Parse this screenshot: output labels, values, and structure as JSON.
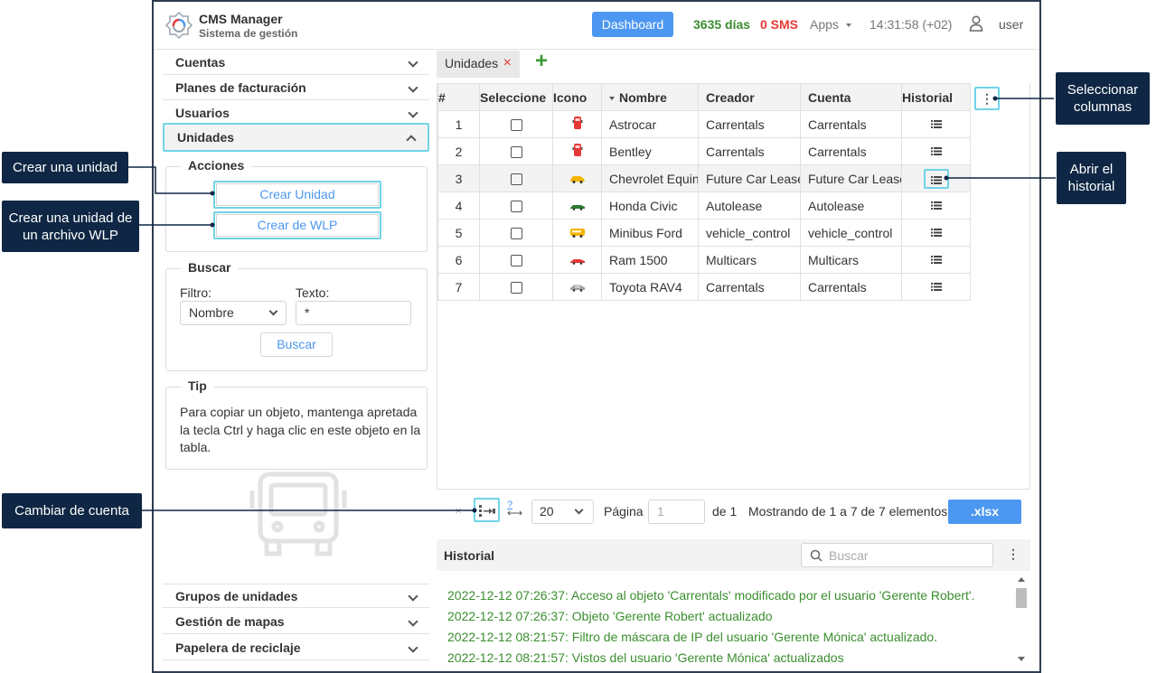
{
  "header": {
    "app_title": "CMS Manager",
    "app_subtitle": "Sistema de gestión",
    "dashboard_label": "Dashboard",
    "days": "3635 días",
    "sms": "0 SMS",
    "apps": "Apps",
    "time": "14:31:58 (+02)",
    "user": "user"
  },
  "sidebar": {
    "items_top": [
      "Cuentas",
      "Planes de facturación",
      "Usuarios"
    ],
    "active_item": "Unidades",
    "items_bottom": [
      "Grupos de unidades",
      "Gestión de mapas",
      "Papelera de reciclaje"
    ],
    "actions": {
      "legend": "Acciones",
      "create_unit": "Crear Unidad",
      "create_wlp": "Crear de WLP"
    },
    "search": {
      "legend": "Buscar",
      "filter_label": "Filtro:",
      "filter_value": "Nombre",
      "text_label": "Texto:",
      "text_value": "*",
      "button": "Buscar"
    },
    "tip": {
      "legend": "Tip",
      "text": "Para copiar un objeto, mantenga apretada la tecla Ctrl y haga clic en este objeto en la tabla."
    }
  },
  "tabs": {
    "active": "Unidades",
    "close": "×",
    "add": "+"
  },
  "grid": {
    "columns": [
      "#",
      "Seleccione",
      "Icono",
      "Nombre",
      "Creador",
      "Cuenta",
      "Historial"
    ],
    "rows": [
      {
        "num": "1",
        "name": "Astrocar",
        "creator": "Carrentals",
        "account": "Carrentals",
        "icon": "red-fire-truck-icon"
      },
      {
        "num": "2",
        "name": "Bentley",
        "creator": "Carrentals",
        "account": "Carrentals",
        "icon": "red-fire-truck-icon"
      },
      {
        "num": "3",
        "name": "Chevrolet Equinox",
        "creator": "Future Car Lease",
        "account": "Future Car Lease",
        "icon": "yellow-car-icon"
      },
      {
        "num": "4",
        "name": "Honda Civic",
        "creator": "Autolease",
        "account": "Autolease",
        "icon": "green-car-icon"
      },
      {
        "num": "5",
        "name": "Minibus Ford",
        "creator": "vehicle_control",
        "account": "vehicle_control",
        "icon": "yellow-bus-icon"
      },
      {
        "num": "6",
        "name": "Ram 1500",
        "creator": "Multicars",
        "account": "Multicars",
        "icon": "red-car-icon"
      },
      {
        "num": "7",
        "name": "Toyota RAV4",
        "creator": "Carrentals",
        "account": "Carrentals",
        "icon": "gray-car-icon"
      }
    ],
    "column_menu": "⋮"
  },
  "pager": {
    "clear": "×",
    "help": "?",
    "page_size": "20",
    "page_label": "Página",
    "page_value": "1",
    "of_label": "de 1",
    "showing": "Mostrando de 1 a 7 de 7 elementos.",
    "export": ".xlsx"
  },
  "history": {
    "title": "Historial",
    "search_placeholder": "Buscar",
    "menu": "⋮",
    "entries": [
      "2022-12-12 07:26:37: Acceso al objeto 'Carrentals' modificado por el usuario 'Gerente Robert'.",
      "2022-12-12 07:26:37: Objeto 'Gerente Robert' actualizado",
      "2022-12-12 08:21:57: Filtro de máscara de IP del usuario 'Gerente Mónica' actualizado.",
      "2022-12-12 08:21:57: Vistos del usuario 'Gerente Mónica' actualizados"
    ]
  },
  "callouts": {
    "create_unit": "Crear una unidad",
    "create_wlp": "Crear una unidad de un archivo WLP",
    "change_account": "Cambiar de cuenta",
    "select_columns": "Seleccionar columnas",
    "open_history": "Abrir el historial"
  },
  "colors": {
    "accent": "#4c97f1",
    "highlight": "#6fd4e7",
    "callout_bg": "#0f2744",
    "positive": "#3a8e2e",
    "negative": "#e53935"
  }
}
